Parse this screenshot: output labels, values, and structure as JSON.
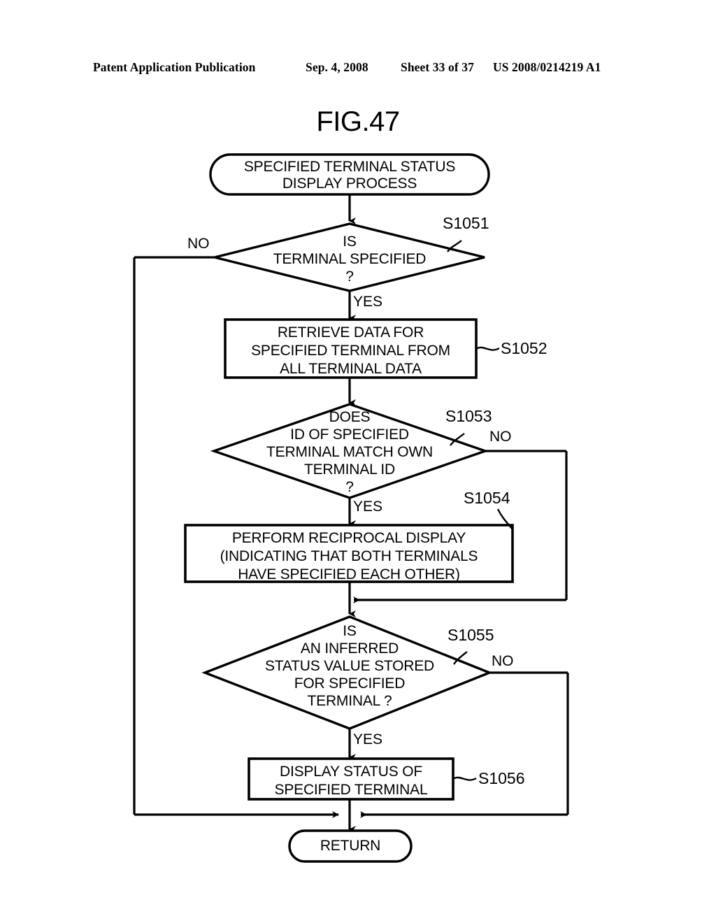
{
  "header": {
    "publication": "Patent Application Publication",
    "date": "Sep. 4, 2008",
    "sheet": "Sheet 33 of 37",
    "patent_number": "US 2008/0214219 A1"
  },
  "figure": {
    "title": "FIG.47"
  },
  "flowchart": {
    "start": {
      "id": "start-terminator",
      "text": "SPECIFIED TERMINAL STATUS\nDISPLAY PROCESS"
    },
    "nodes": [
      {
        "id": "s1051",
        "type": "decision",
        "step": "S1051",
        "text": "IS\nTERMINAL SPECIFIED\n?",
        "yes": "YES",
        "no": "NO"
      },
      {
        "id": "s1052",
        "type": "process",
        "step": "S1052",
        "text": "RETRIEVE DATA FOR\nSPECIFIED TERMINAL FROM\nALL TERMINAL DATA"
      },
      {
        "id": "s1053",
        "type": "decision",
        "step": "S1053",
        "text": "DOES\nID OF SPECIFIED\nTERMINAL MATCH OWN\nTERMINAL ID\n?",
        "yes": "YES",
        "no": "NO"
      },
      {
        "id": "s1054",
        "type": "process",
        "step": "S1054",
        "text": "PERFORM RECIPROCAL DISPLAY\n(INDICATING THAT BOTH TERMINALS\nHAVE SPECIFIED EACH OTHER)"
      },
      {
        "id": "s1055",
        "type": "decision",
        "step": "S1055",
        "text": "IS\nAN INFERRED\nSTATUS VALUE STORED\nFOR SPECIFIED\nTERMINAL ?",
        "yes": "YES",
        "no": "NO"
      },
      {
        "id": "s1056",
        "type": "process",
        "step": "S1056",
        "text": "DISPLAY STATUS OF\nSPECIFIED TERMINAL"
      }
    ],
    "end": {
      "id": "return-terminator",
      "text": "RETURN"
    },
    "colors": {
      "line": "#000000",
      "background": "#ffffff"
    }
  }
}
